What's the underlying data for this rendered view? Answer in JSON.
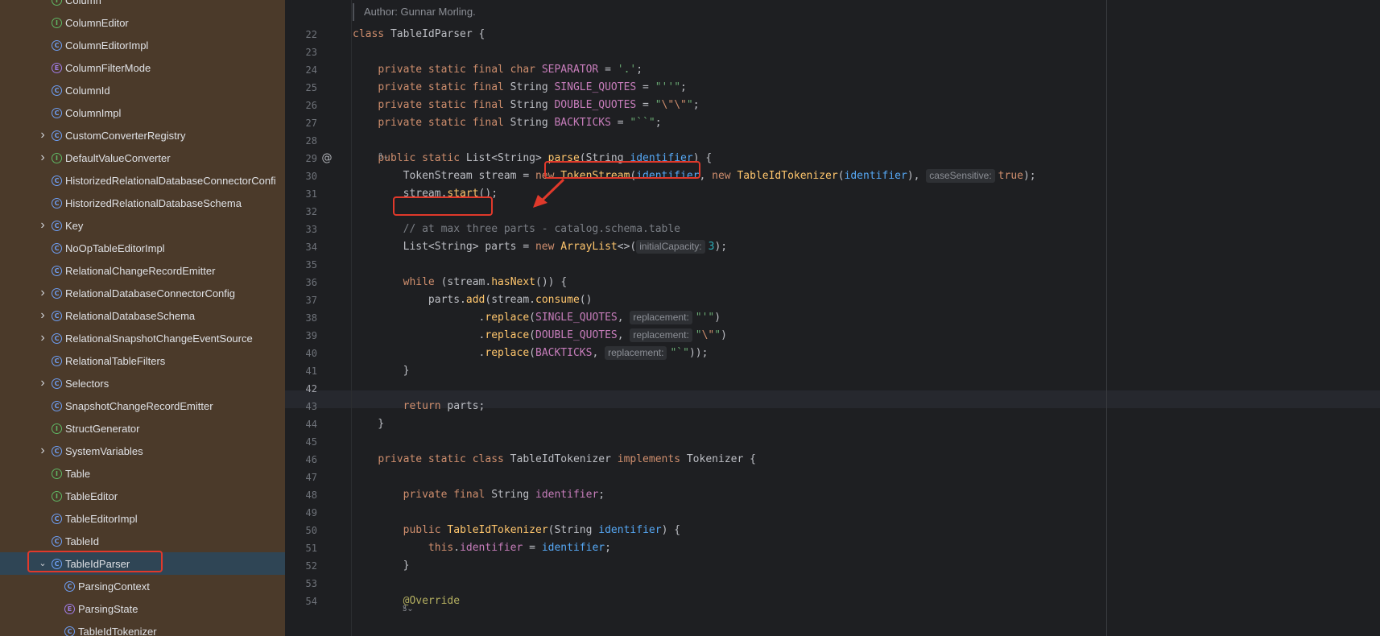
{
  "sidebar": {
    "items": [
      {
        "label": "Column",
        "icon": "interface",
        "chevron": false,
        "indent": 1
      },
      {
        "label": "ColumnEditor",
        "icon": "interface",
        "chevron": false,
        "indent": 1
      },
      {
        "label": "ColumnEditorImpl",
        "icon": "class",
        "chevron": false,
        "indent": 1
      },
      {
        "label": "ColumnFilterMode",
        "icon": "enum",
        "chevron": false,
        "indent": 1
      },
      {
        "label": "ColumnId",
        "icon": "class",
        "chevron": false,
        "indent": 1
      },
      {
        "label": "ColumnImpl",
        "icon": "class",
        "chevron": false,
        "indent": 1
      },
      {
        "label": "CustomConverterRegistry",
        "icon": "class",
        "chevron": "right",
        "indent": 1
      },
      {
        "label": "DefaultValueConverter",
        "icon": "interface",
        "chevron": "right",
        "indent": 1
      },
      {
        "label": "HistorizedRelationalDatabaseConnectorConfi",
        "icon": "class",
        "chevron": false,
        "indent": 1
      },
      {
        "label": "HistorizedRelationalDatabaseSchema",
        "icon": "class",
        "chevron": false,
        "indent": 1
      },
      {
        "label": "Key",
        "icon": "class",
        "chevron": "right",
        "indent": 1
      },
      {
        "label": "NoOpTableEditorImpl",
        "icon": "class",
        "chevron": false,
        "indent": 1
      },
      {
        "label": "RelationalChangeRecordEmitter",
        "icon": "class",
        "chevron": false,
        "indent": 1
      },
      {
        "label": "RelationalDatabaseConnectorConfig",
        "icon": "class",
        "chevron": "right",
        "indent": 1
      },
      {
        "label": "RelationalDatabaseSchema",
        "icon": "class",
        "chevron": "right",
        "indent": 1
      },
      {
        "label": "RelationalSnapshotChangeEventSource",
        "icon": "class",
        "chevron": "right",
        "indent": 1
      },
      {
        "label": "RelationalTableFilters",
        "icon": "class",
        "chevron": false,
        "indent": 1
      },
      {
        "label": "Selectors",
        "icon": "class",
        "chevron": "right",
        "indent": 1
      },
      {
        "label": "SnapshotChangeRecordEmitter",
        "icon": "class",
        "chevron": false,
        "indent": 1
      },
      {
        "label": "StructGenerator",
        "icon": "interface",
        "chevron": false,
        "indent": 1
      },
      {
        "label": "SystemVariables",
        "icon": "class",
        "chevron": "right",
        "indent": 1
      },
      {
        "label": "Table",
        "icon": "interface",
        "chevron": false,
        "indent": 1
      },
      {
        "label": "TableEditor",
        "icon": "interface",
        "chevron": false,
        "indent": 1
      },
      {
        "label": "TableEditorImpl",
        "icon": "class",
        "chevron": false,
        "indent": 1
      },
      {
        "label": "TableId",
        "icon": "class",
        "chevron": false,
        "indent": 1
      },
      {
        "label": "TableIdParser",
        "icon": "class",
        "chevron": "down",
        "indent": 1,
        "selected": true
      },
      {
        "label": "ParsingContext",
        "icon": "class",
        "chevron": false,
        "indent": 2
      },
      {
        "label": "ParsingState",
        "icon": "enum",
        "chevron": false,
        "indent": 2
      },
      {
        "label": "TableIdTokenizer",
        "icon": "class",
        "chevron": false,
        "indent": 2
      }
    ]
  },
  "editor": {
    "author_label": "Author:",
    "author_name": "Gunnar Morling.",
    "current_line": "42",
    "hint_glyph": "ꝸ⌄",
    "lines": [
      {
        "n": "22",
        "html": "<span class='kw'>class</span> TableIdParser {"
      },
      {
        "n": "23",
        "html": ""
      },
      {
        "n": "24",
        "html": "    <span class='kw'>private static final char</span> <span class='fld'>SEPARATOR</span> = <span class='str'>'.'</span>;"
      },
      {
        "n": "25",
        "html": "    <span class='kw'>private static final</span> String <span class='fld'>SINGLE_QUOTES</span> = <span class='str'>\"''\"</span>;"
      },
      {
        "n": "26",
        "html": "    <span class='kw'>private static final</span> String <span class='fld'>DOUBLE_QUOTES</span> = <span class='str'>\"<span class='kw'>\\\"\\\"</span>\"</span>;"
      },
      {
        "n": "27",
        "html": "    <span class='kw'>private static final</span> String <span class='fld'>BACKTICKS</span> = <span class='str'>\"``\"</span>;"
      },
      {
        "n": "28",
        "html": ""
      },
      {
        "n": "29",
        "html": "    <span class='kw'>public static</span> List&lt;String&gt; <span class='met'>parse</span>(String <span class='prm'>identifier</span>) {",
        "at": true
      },
      {
        "n": "30",
        "html": "        TokenStream stream = <span class='kw'>new</span> <span class='met'>TokenStream</span>(<span class='prm'>identifier</span>, <span class='kw'>new</span> <span class='met'>TableIdTokenizer</span>(<span class='prm'>identifier</span>), <span class='hint'>caseSensitive:</span><span class='kw'>true</span>);"
      },
      {
        "n": "31",
        "html": "        stream.<span class='met'>start</span>();"
      },
      {
        "n": "32",
        "html": ""
      },
      {
        "n": "33",
        "html": "        <span class='cmt'>// at max three parts - catalog.schema.table</span>"
      },
      {
        "n": "34",
        "html": "        List&lt;String&gt; parts = <span class='kw'>new</span> <span class='met'>ArrayList</span>&lt;&gt;(<span class='hint'>initialCapacity:</span><span class='num'>3</span>);"
      },
      {
        "n": "35",
        "html": ""
      },
      {
        "n": "36",
        "html": "        <span class='kw'>while</span> (stream.<span class='met'>hasNext</span>()) {"
      },
      {
        "n": "37",
        "html": "            parts.<span class='met'>add</span>(stream.<span class='met'>consume</span>()"
      },
      {
        "n": "38",
        "html": "                    .<span class='met'>replace</span>(<span class='fld'>SINGLE_QUOTES</span>, <span class='hint'>replacement:</span><span class='str'>\"'\"</span>)"
      },
      {
        "n": "39",
        "html": "                    .<span class='met'>replace</span>(<span class='fld'>DOUBLE_QUOTES</span>, <span class='hint'>replacement:</span><span class='str'>\"<span class='kw'>\\\"</span>\"</span>)"
      },
      {
        "n": "40",
        "html": "                    .<span class='met'>replace</span>(<span class='fld'>BACKTICKS</span>, <span class='hint'>replacement:</span><span class='str'>\"`\"</span>));"
      },
      {
        "n": "41",
        "html": "        }"
      },
      {
        "n": "42",
        "html": ""
      },
      {
        "n": "43",
        "html": "        <span class='kw'>return</span> parts;"
      },
      {
        "n": "44",
        "html": "    }"
      },
      {
        "n": "45",
        "html": ""
      },
      {
        "n": "46",
        "html": "    <span class='kw'>private static class</span> TableIdTokenizer <span class='kw'>implements</span> Tokenizer {"
      },
      {
        "n": "47",
        "html": ""
      },
      {
        "n": "48",
        "html": "        <span class='kw'>private final</span> String <span class='fld'>identifier</span>;"
      },
      {
        "n": "49",
        "html": ""
      },
      {
        "n": "50",
        "html": "        <span class='kw'>public</span> <span class='met'>TableIdTokenizer</span>(String <span class='prm'>identifier</span>) {"
      },
      {
        "n": "51",
        "html": "            <span class='kw'>this</span>.<span class='fld'>identifier</span> = <span class='prm'>identifier</span>;"
      },
      {
        "n": "52",
        "html": "        }"
      },
      {
        "n": "53",
        "html": ""
      },
      {
        "n": "54",
        "html": "        <span class='ann'>@Override</span>"
      }
    ]
  },
  "colors": {
    "sidebar_bg": "#4b3a2a",
    "editor_bg": "#1e1f22",
    "highlight_red": "#e0392b",
    "selected_bg": "#2f4555"
  },
  "icons": {
    "class": "C",
    "interface": "I",
    "enum": "E",
    "at": "@"
  }
}
